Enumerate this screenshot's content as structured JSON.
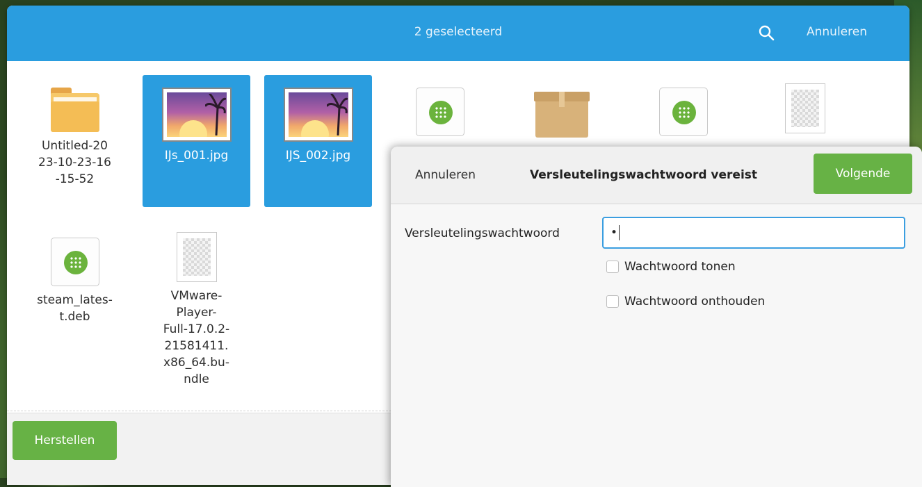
{
  "header": {
    "title": "2 geselecteerd",
    "cancel_label": "Annuleren"
  },
  "files": [
    {
      "name": "Untitled-2023-10-23-16-15-52",
      "display": "Untitled-20\n23-10-23-16\n-15-52",
      "type": "folder",
      "selected": false
    },
    {
      "name": "IJs_001.jpg",
      "type": "image",
      "selected": true
    },
    {
      "name": "IJS_002.jpg",
      "type": "image",
      "selected": true
    },
    {
      "name": "",
      "type": "deb",
      "selected": false
    },
    {
      "name": "",
      "type": "archive",
      "selected": false
    },
    {
      "name": "",
      "type": "deb",
      "selected": false
    },
    {
      "name": "",
      "type": "blank",
      "selected": false
    },
    {
      "name": "steam_latest.deb",
      "display": "steam_lates-\nt.deb",
      "type": "deb",
      "selected": false
    },
    {
      "name": "VMware-Player-Full-17.0.2-21581411.x86_64.bundle",
      "display": "VMware-\nPlayer-\nFull-17.0.2-\n21581411.\nx86_64.bu-\nndle",
      "type": "blank",
      "selected": false
    }
  ],
  "footer": {
    "restore_label": "Herstellen"
  },
  "dialog": {
    "cancel_label": "Annuleren",
    "title": "Versleutelingswachtwoord vereist",
    "next_label": "Volgende",
    "password_label": "Versleutelingswachtwoord",
    "password_value": "•",
    "show_password_label": "Wachtwoord tonen",
    "remember_password_label": "Wachtwoord onthouden"
  },
  "colors": {
    "header_blue": "#2a9ddf",
    "selection_blue": "#2a9ddf",
    "action_green": "#67b245"
  },
  "icons": [
    "search-icon",
    "folder-icon",
    "image-icon",
    "deb-package-icon",
    "archive-icon",
    "blank-file-icon"
  ]
}
